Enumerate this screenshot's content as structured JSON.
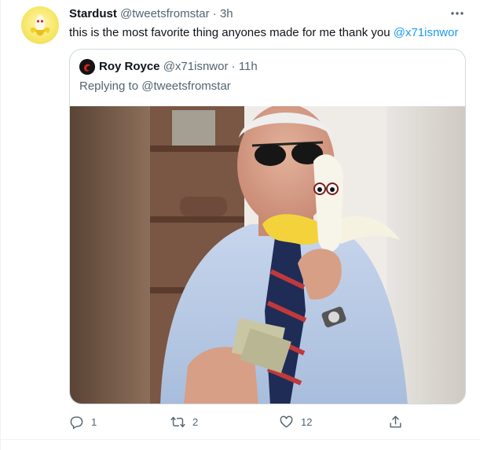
{
  "tweet": {
    "author_name": "Stardust",
    "author_handle": "@tweetsfromstar",
    "separator": "·",
    "time": "3h",
    "text": "this is the most favorite thing anyones made for me thank you ",
    "mention": "@x71isnwor"
  },
  "quote": {
    "author_name": "Roy Royce",
    "author_handle": "@x71isnwor",
    "separator": "·",
    "time": "11h",
    "replying_to": "Replying to @tweetsfromstar"
  },
  "actions": {
    "reply_count": "1",
    "retweet_count": "2",
    "like_count": "12"
  },
  "colors": {
    "accent": "#1d9bf0",
    "muted_text": "#536471",
    "border": "#cfd9de"
  },
  "icons": [
    "more-icon",
    "reply-icon",
    "retweet-icon",
    "like-icon",
    "share-icon"
  ]
}
